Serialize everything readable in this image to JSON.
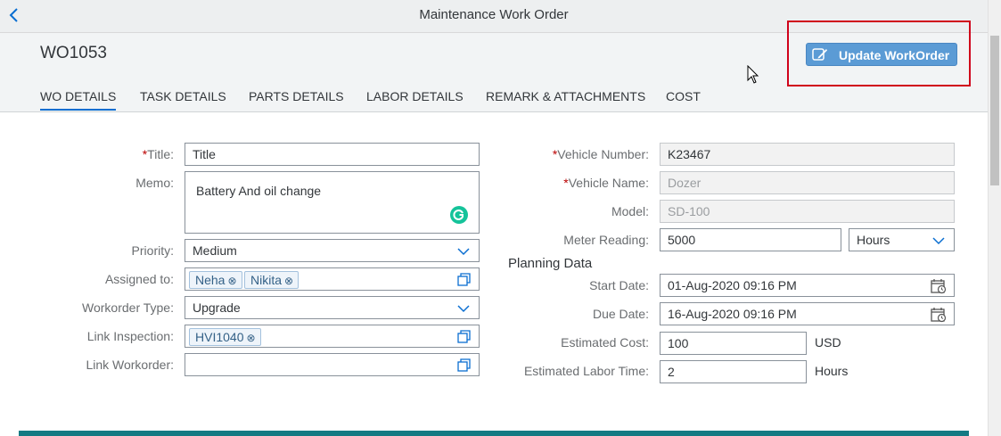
{
  "shell": {
    "title": "Maintenance Work Order",
    "back_icon": "chevron-left-icon"
  },
  "header": {
    "object_title": "WO1053",
    "update_button": {
      "label": "Update WorkOrder",
      "icon": "edit-icon"
    }
  },
  "tabs": [
    {
      "label": "WO DETAILS",
      "active": true
    },
    {
      "label": "TASK DETAILS"
    },
    {
      "label": "PARTS DETAILS"
    },
    {
      "label": "LABOR DETAILS"
    },
    {
      "label": "REMARK & ATTACHMENTS"
    },
    {
      "label": "COST"
    }
  ],
  "left_form": {
    "title": {
      "required_mark": "*",
      "label": "Title:",
      "value": "Title"
    },
    "memo": {
      "label": "Memo:",
      "value": "Battery And oil change"
    },
    "priority": {
      "label": "Priority:",
      "value": "Medium"
    },
    "assigned_to": {
      "label": "Assigned to:",
      "tokens": [
        "Neha",
        "Nikita"
      ]
    },
    "workorder_type": {
      "label": "Workorder Type:",
      "value": "Upgrade"
    },
    "link_inspection": {
      "label": "Link Inspection:",
      "tokens": [
        "HVI1040"
      ]
    },
    "link_workorder": {
      "label": "Link Workorder:",
      "value": ""
    }
  },
  "right_form": {
    "vehicle_number": {
      "required_mark": "*",
      "label": "Vehicle Number:",
      "value": "K23467"
    },
    "vehicle_name": {
      "required_mark": "*",
      "label": "Vehicle Name:",
      "value": "Dozer"
    },
    "model": {
      "label": "Model:",
      "value": "SD-100"
    },
    "meter_reading": {
      "label": "Meter Reading:",
      "value": "5000",
      "unit": "Hours"
    },
    "planning_title": "Planning Data",
    "start_date": {
      "label": "Start Date:",
      "value": "01-Aug-2020 09:16 PM"
    },
    "due_date": {
      "label": "Due Date:",
      "value": "16-Aug-2020 09:16 PM"
    },
    "estimated_cost": {
      "label": "Estimated Cost:",
      "value": "100",
      "unit": "USD"
    },
    "estimated_labor_time": {
      "label": "Estimated Labor Time:",
      "value": "2",
      "unit": "Hours"
    }
  },
  "colors": {
    "accent": "#0a6ed1",
    "button": "#5b9bd5",
    "highlight": "#d0021b",
    "required": "#bb0000",
    "footer": "#147a83"
  }
}
